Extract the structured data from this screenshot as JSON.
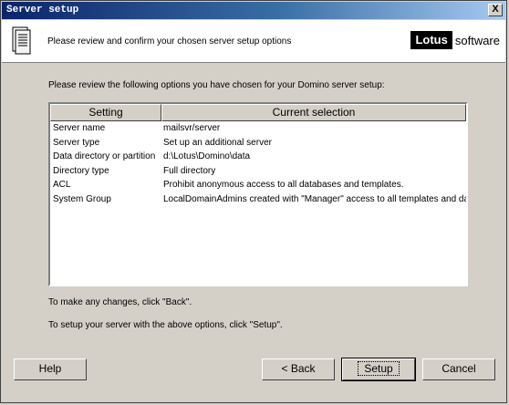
{
  "window": {
    "title": "Server setup",
    "close_label": "X"
  },
  "header": {
    "instruction": "Please review and confirm your chosen server setup options",
    "logo_brand": "Lotus",
    "logo_suffix": "software"
  },
  "intro": "Please review the following options you have chosen for your Domino server setup:",
  "table": {
    "columns": [
      "Setting",
      "Current selection"
    ],
    "rows": [
      {
        "setting": "Server name",
        "value": "mailsvr/server"
      },
      {
        "setting": "Server type",
        "value": "Set up an additional server"
      },
      {
        "setting": "Data directory or partition",
        "value": "d:\\Lotus\\Domino\\data"
      },
      {
        "setting": "Directory type",
        "value": "Full directory"
      },
      {
        "setting": "ACL",
        "value": "Prohibit  anonymous access to all databases and templates."
      },
      {
        "setting": "System Group",
        "value": "LocalDomainAdmins created with \"Manager\" access to all templates and data..."
      }
    ]
  },
  "notes": {
    "changes": "To make any changes, click \"Back\".",
    "setup": "To setup your server with the above options, click \"Setup\"."
  },
  "buttons": {
    "help": "Help",
    "back": "< Back",
    "setup": "Setup",
    "cancel": "Cancel"
  }
}
